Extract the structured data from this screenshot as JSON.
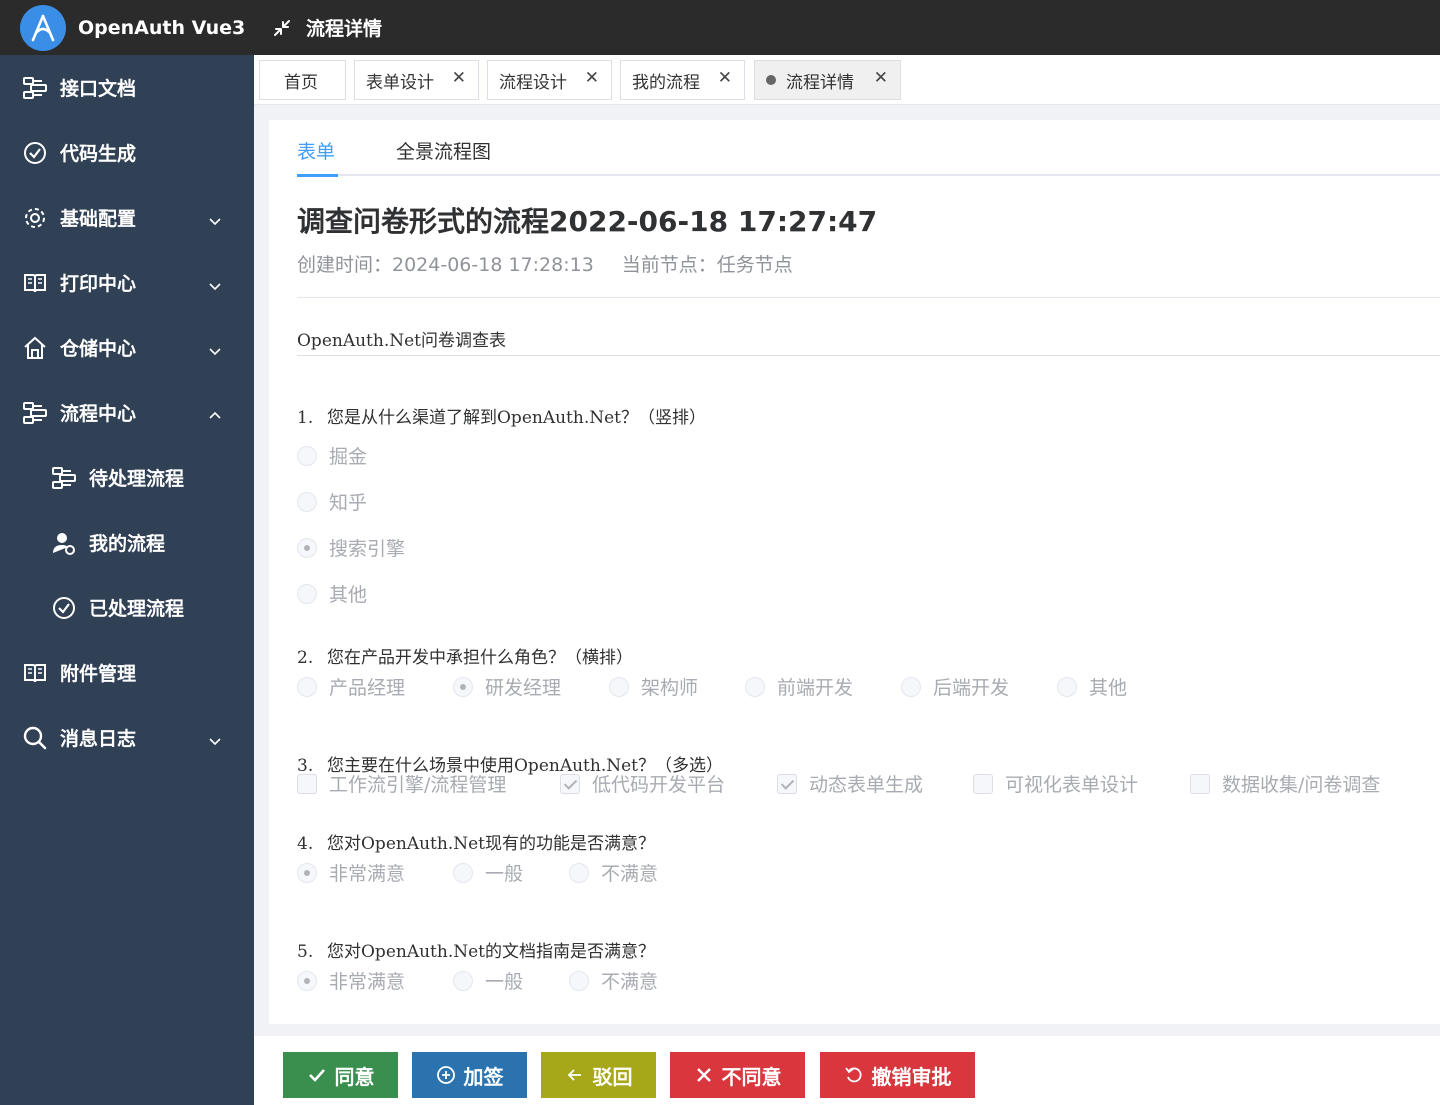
{
  "header": {
    "app_name": "OpenAuth Vue3",
    "page_title": "流程详情"
  },
  "sidebar": {
    "items": [
      {
        "label": "接口文档",
        "icon": "flow-icon",
        "sub": false,
        "chevron": ""
      },
      {
        "label": "代码生成",
        "icon": "check-circle-icon",
        "sub": false,
        "chevron": ""
      },
      {
        "label": "基础配置",
        "icon": "gear-icon",
        "sub": false,
        "chevron": "down"
      },
      {
        "label": "打印中心",
        "icon": "book-icon",
        "sub": false,
        "chevron": "down"
      },
      {
        "label": "仓储中心",
        "icon": "home-icon",
        "sub": false,
        "chevron": "down"
      },
      {
        "label": "流程中心",
        "icon": "flow-icon",
        "sub": false,
        "chevron": "up"
      },
      {
        "label": "待处理流程",
        "icon": "flow-icon",
        "sub": true,
        "chevron": ""
      },
      {
        "label": "我的流程",
        "icon": "user-gear-icon",
        "sub": true,
        "chevron": ""
      },
      {
        "label": "已处理流程",
        "icon": "check-circle-icon",
        "sub": true,
        "chevron": ""
      },
      {
        "label": "附件管理",
        "icon": "book-icon",
        "sub": false,
        "chevron": ""
      },
      {
        "label": "消息日志",
        "icon": "search-icon",
        "sub": false,
        "chevron": "down"
      }
    ]
  },
  "tags": [
    {
      "label": "首页",
      "closable": false,
      "active": false
    },
    {
      "label": "表单设计",
      "closable": true,
      "active": false
    },
    {
      "label": "流程设计",
      "closable": true,
      "active": false
    },
    {
      "label": "我的流程",
      "closable": true,
      "active": false
    },
    {
      "label": "流程详情",
      "closable": true,
      "active": true
    }
  ],
  "tabs": [
    {
      "label": "表单",
      "active": true
    },
    {
      "label": "全景流程图",
      "active": false
    }
  ],
  "flow": {
    "title": "调查问卷形式的流程2022-06-18 17:27:47",
    "created": "创建时间：2024-06-18 17:28:13",
    "node": "当前节点：任务节点"
  },
  "form": {
    "heading": "OpenAuth.Net问卷调查表",
    "questions": [
      {
        "num": "1.",
        "text": "您是从什么渠道了解到OpenAuth.Net？（竖排）",
        "type": "radio",
        "options": [
          "掘金",
          "知乎",
          "搜索引擎",
          "其他"
        ],
        "selected": [
          2
        ]
      },
      {
        "num": "2.",
        "text": "您在产品开发中承担什么角色？（横排）",
        "type": "radio",
        "options": [
          "产品经理",
          "研发经理",
          "架构师",
          "前端开发",
          "后端开发",
          "其他"
        ],
        "selected": [
          1
        ]
      },
      {
        "num": "3.",
        "text": "您主要在什么场景中使用OpenAuth.Net？（多选）",
        "type": "checkbox",
        "options": [
          "工作流引擎/流程管理",
          "低代码开发平台",
          "动态表单生成",
          "可视化表单设计",
          "数据收集/问卷调查"
        ],
        "selected": [
          1,
          2
        ]
      },
      {
        "num": "4.",
        "text": "您对OpenAuth.Net现有的功能是否满意？",
        "type": "radio",
        "options": [
          "非常满意",
          "一般",
          "不满意"
        ],
        "selected": [
          0
        ]
      },
      {
        "num": "5.",
        "text": "您对OpenAuth.Net的文档指南是否满意？",
        "type": "radio",
        "options": [
          "非常满意",
          "一般",
          "不满意"
        ],
        "selected": [
          0
        ]
      }
    ]
  },
  "actions": [
    {
      "label": "同意",
      "icon": "check-icon",
      "color": "#3a8f4e"
    },
    {
      "label": "加签",
      "icon": "plus-circle-icon",
      "color": "#2a73ae"
    },
    {
      "label": "驳回",
      "icon": "arrow-left-icon",
      "color": "#a6a81a"
    },
    {
      "label": "不同意",
      "icon": "close-icon",
      "color": "#d9363e"
    },
    {
      "label": "撤销审批",
      "icon": "undo-icon",
      "color": "#d9363e"
    }
  ]
}
